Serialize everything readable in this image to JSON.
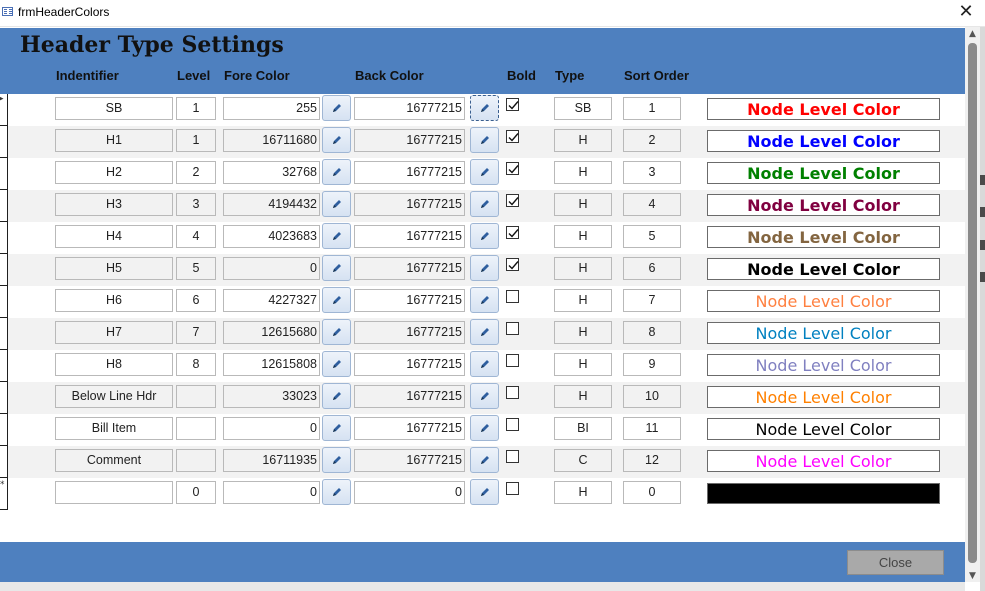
{
  "window": {
    "title": "frmHeaderColors",
    "close_glyph": "✕"
  },
  "header": {
    "title": "Header Type Settings",
    "columns": {
      "identifier": "Indentifier",
      "level": "Level",
      "fore_color": "Fore Color",
      "back_color": "Back Color",
      "bold": "Bold",
      "type": "Type",
      "sort_order": "Sort Order"
    }
  },
  "icons": {
    "picker": "pencil-icon",
    "checkbox": "checkmark-icon",
    "window": "form-icon"
  },
  "rows": [
    {
      "identifier": "SB",
      "level": "1",
      "fore": "255",
      "back": "16777215",
      "bold": true,
      "type": "SB",
      "sort": "1",
      "sample": "Node Level Color",
      "sample_fg": "#ff0000",
      "sample_bg": "#ffffff",
      "sample_bold": true
    },
    {
      "identifier": "H1",
      "level": "1",
      "fore": "16711680",
      "back": "16777215",
      "bold": true,
      "type": "H",
      "sort": "2",
      "sample": "Node Level Color",
      "sample_fg": "#0000ff",
      "sample_bg": "#ffffff",
      "sample_bold": true
    },
    {
      "identifier": "H2",
      "level": "2",
      "fore": "32768",
      "back": "16777215",
      "bold": true,
      "type": "H",
      "sort": "3",
      "sample": "Node Level Color",
      "sample_fg": "#008000",
      "sample_bg": "#ffffff",
      "sample_bold": true
    },
    {
      "identifier": "H3",
      "level": "3",
      "fore": "4194432",
      "back": "16777215",
      "bold": true,
      "type": "H",
      "sort": "4",
      "sample": "Node Level Color",
      "sample_fg": "#800040",
      "sample_bg": "#ffffff",
      "sample_bold": true
    },
    {
      "identifier": "H4",
      "level": "4",
      "fore": "4023683",
      "back": "16777215",
      "bold": true,
      "type": "H",
      "sort": "5",
      "sample": "Node Level Color",
      "sample_fg": "#836540",
      "sample_bg": "#ffffff",
      "sample_bold": true
    },
    {
      "identifier": "H5",
      "level": "5",
      "fore": "0",
      "back": "16777215",
      "bold": true,
      "type": "H",
      "sort": "6",
      "sample": "Node Level Color",
      "sample_fg": "#000000",
      "sample_bg": "#ffffff",
      "sample_bold": true
    },
    {
      "identifier": "H6",
      "level": "6",
      "fore": "4227327",
      "back": "16777215",
      "bold": false,
      "type": "H",
      "sort": "7",
      "sample": "Node Level Color",
      "sample_fg": "#ff8040",
      "sample_bg": "#ffffff",
      "sample_bold": false
    },
    {
      "identifier": "H7",
      "level": "7",
      "fore": "12615680",
      "back": "16777215",
      "bold": false,
      "type": "H",
      "sort": "8",
      "sample": "Node Level Color",
      "sample_fg": "#0080c0",
      "sample_bg": "#ffffff",
      "sample_bold": false
    },
    {
      "identifier": "H8",
      "level": "8",
      "fore": "12615808",
      "back": "16777215",
      "bold": false,
      "type": "H",
      "sort": "9",
      "sample": "Node Level Color",
      "sample_fg": "#8080c0",
      "sample_bg": "#ffffff",
      "sample_bold": false
    },
    {
      "identifier": "Below Line Hdr",
      "level": "",
      "fore": "33023",
      "back": "16777215",
      "bold": false,
      "type": "H",
      "sort": "10",
      "sample": "Node Level Color",
      "sample_fg": "#ff8000",
      "sample_bg": "#ffffff",
      "sample_bold": false
    },
    {
      "identifier": "Bill Item",
      "level": "",
      "fore": "0",
      "back": "16777215",
      "bold": false,
      "type": "BI",
      "sort": "11",
      "sample": "Node Level Color",
      "sample_fg": "#000000",
      "sample_bg": "#ffffff",
      "sample_bold": false
    },
    {
      "identifier": "Comment",
      "level": "",
      "fore": "16711935",
      "back": "16777215",
      "bold": false,
      "type": "C",
      "sort": "12",
      "sample": "Node Level Color",
      "sample_fg": "#ff00ff",
      "sample_bg": "#ffffff",
      "sample_bold": false
    },
    {
      "identifier": "",
      "level": "0",
      "fore": "0",
      "back": "0",
      "bold": false,
      "type": "H",
      "sort": "0",
      "sample": "",
      "sample_fg": "#000000",
      "sample_bg": "#000000",
      "sample_bold": false,
      "new_record": true
    }
  ],
  "footer": {
    "close_label": "Close"
  },
  "colors": {
    "band": "#4e80bf",
    "close_button": "#a9a9a9"
  }
}
